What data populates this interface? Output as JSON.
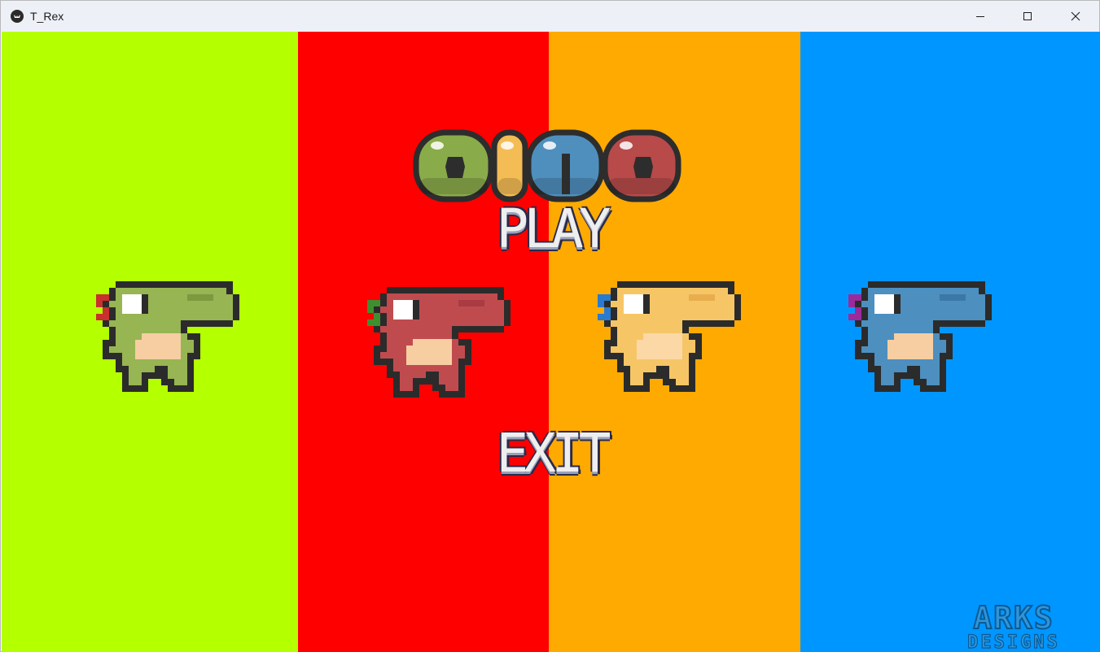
{
  "window": {
    "title": "T_Rex",
    "controls": {
      "minimize": "minimize",
      "maximize": "maximize",
      "close": "close"
    }
  },
  "background": {
    "stripe_colors": [
      "#b4ff00",
      "#ff0000",
      "#ffaa00",
      "#0096ff"
    ]
  },
  "logo": {
    "letters": [
      "D",
      "I",
      "N",
      "O"
    ],
    "letter_colors": [
      "#8aab4a",
      "#f4bc55",
      "#4f8fbd",
      "#b84a4a"
    ]
  },
  "menu": {
    "play_label": "PLAY",
    "exit_label": "EXIT"
  },
  "characters": [
    {
      "name": "green",
      "body": "#97b552",
      "shade": "#7d9a40",
      "belly": "#f6cea2",
      "crest": "#c9302e"
    },
    {
      "name": "red",
      "body": "#c04b4f",
      "shade": "#a83c42",
      "belly": "#f6cea2",
      "crest": "#3f8f31"
    },
    {
      "name": "yellow",
      "body": "#f6c666",
      "shade": "#e8ad4c",
      "belly": "#fbd8a6",
      "crest": "#2a7ad0"
    },
    {
      "name": "blue",
      "body": "#4d8fbf",
      "shade": "#3b78a8",
      "belly": "#f6cea2",
      "crest": "#9b2a9b"
    }
  ],
  "watermark": {
    "line1": "ARKS",
    "line2": "DESIGNS"
  }
}
